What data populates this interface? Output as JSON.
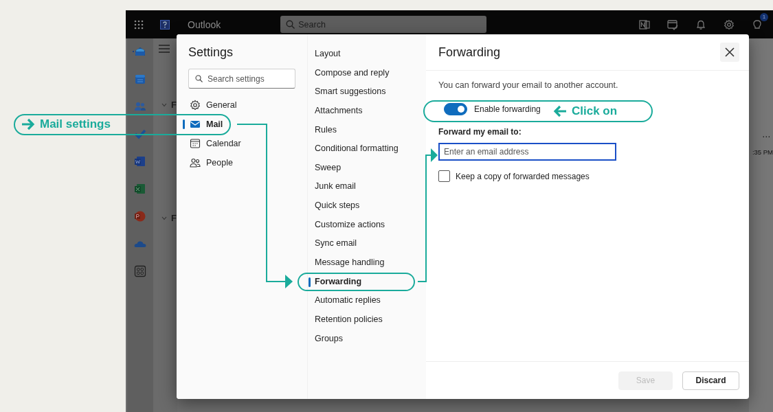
{
  "topbar": {
    "app_name": "Outlook",
    "search_placeholder": "Search",
    "badge": "1"
  },
  "background": {
    "fragments": [
      "F",
      "F"
    ],
    "more": "⋯",
    "time": ":35 PM"
  },
  "settings": {
    "title": "Settings",
    "search_placeholder": "Search settings",
    "categories": [
      {
        "kind": "gear",
        "label": "General",
        "selected": false
      },
      {
        "kind": "mail",
        "label": "Mail",
        "selected": true
      },
      {
        "kind": "calendar",
        "label": "Calendar",
        "selected": false
      },
      {
        "kind": "people",
        "label": "People",
        "selected": false
      }
    ]
  },
  "mail_sections": [
    {
      "label": "Layout",
      "selected": false
    },
    {
      "label": "Compose and reply",
      "selected": false
    },
    {
      "label": "Smart suggestions",
      "selected": false
    },
    {
      "label": "Attachments",
      "selected": false
    },
    {
      "label": "Rules",
      "selected": false
    },
    {
      "label": "Conditional formatting",
      "selected": false
    },
    {
      "label": "Sweep",
      "selected": false
    },
    {
      "label": "Junk email",
      "selected": false
    },
    {
      "label": "Quick steps",
      "selected": false
    },
    {
      "label": "Customize actions",
      "selected": false
    },
    {
      "label": "Sync email",
      "selected": false
    },
    {
      "label": "Message handling",
      "selected": false
    },
    {
      "label": "Forwarding",
      "selected": true
    },
    {
      "label": "Automatic replies",
      "selected": false
    },
    {
      "label": "Retention policies",
      "selected": false
    },
    {
      "label": "Groups",
      "selected": false
    }
  ],
  "panel": {
    "title": "Forwarding",
    "description": "You can forward your email to another account.",
    "toggle": {
      "label": "Enable forwarding",
      "on": true
    },
    "field_label": "Forward my email to:",
    "email_field": {
      "placeholder": "Enter an email address"
    },
    "keep_copy": {
      "label": "Keep a copy of forwarded messages",
      "checked": false
    }
  },
  "buttons": [
    {
      "label": "Save",
      "disabled": true
    },
    {
      "label": "Discard",
      "disabled": false
    }
  ],
  "annotations": [
    {
      "text": "Mail settings"
    },
    {
      "text": "Click on"
    }
  ]
}
